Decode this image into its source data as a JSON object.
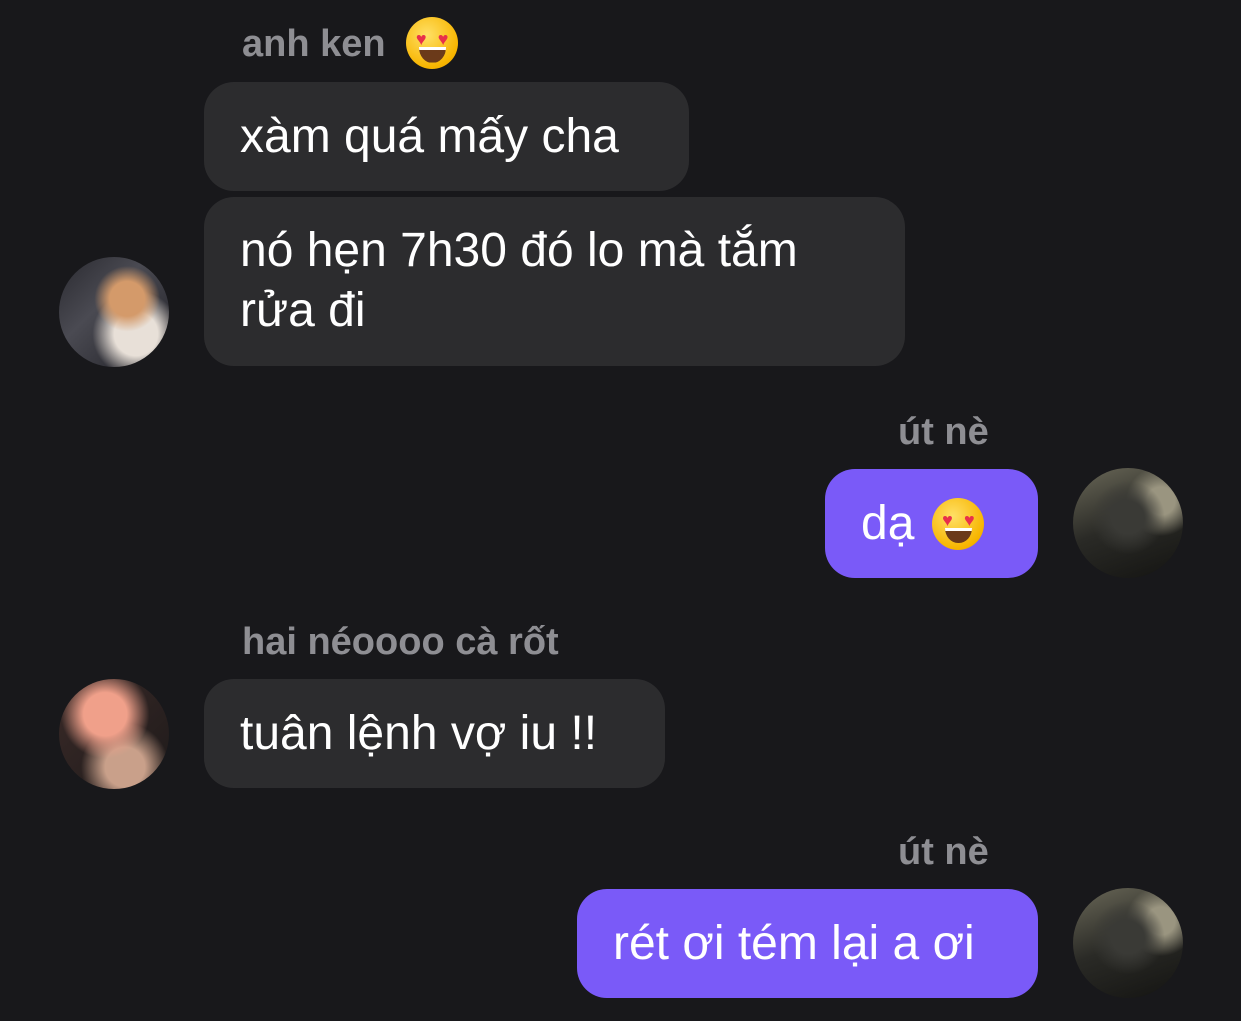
{
  "messages": [
    {
      "sender": "anh ken",
      "sender_emoji": "smiling-face-heart-eyes-icon",
      "text": "xàm quá mấy cha",
      "direction": "incoming"
    },
    {
      "sender": "",
      "text": "nó hẹn 7h30 đó lo mà tắm rửa đi",
      "direction": "incoming",
      "avatar": "avatar-anh-ken"
    },
    {
      "sender": "út nè",
      "text": "dạ",
      "text_emoji": "smiling-face-heart-eyes-icon",
      "direction": "outgoing",
      "avatar": "avatar-ut-ne"
    },
    {
      "sender": "hai néoooo cà rốt",
      "text": "tuân lệnh vợ iu !!",
      "direction": "incoming",
      "avatar": "avatar-hai-neoooo"
    },
    {
      "sender": "út nè",
      "text": "rét ơi tém lại a ơi",
      "direction": "outgoing",
      "avatar": "avatar-ut-ne"
    }
  ],
  "colors": {
    "background": "#18181b",
    "incoming_bubble": "#2c2c2e",
    "outgoing_bubble": "#7a5af8",
    "sender_name": "#8e8e93",
    "message_text": "#ffffff"
  }
}
